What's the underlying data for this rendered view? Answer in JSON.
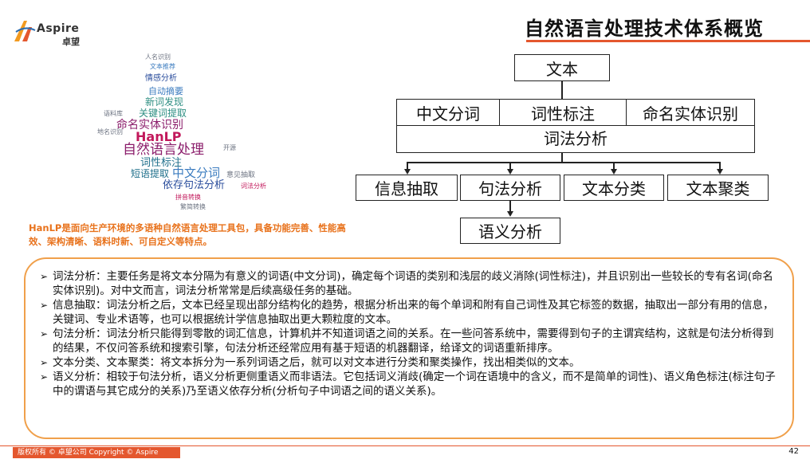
{
  "header": {
    "logo_brand": "Aspire",
    "logo_brand_cn": "卓望",
    "title": "自然语言处理技术体系概览",
    "accent_color": "#e4572e"
  },
  "wordcloud": {
    "words": [
      "自然语言处理",
      "HanLP",
      "命名实体识别",
      "依存句法分析",
      "中文分词",
      "词性标注",
      "关键词提取",
      "新词发现",
      "自动摘要",
      "情感分析",
      "短语提取",
      "人名识别",
      "文本推荐",
      "地名识别",
      "拼音转换",
      "意见抽取",
      "语料库",
      "繁简转换",
      "开源",
      "词法分析"
    ]
  },
  "intro_text": "HanLP是面向生产环境的多语种自然语言处理工具包，具备功能完善、性能高效、架构清晰、语料时新、可自定义等特点。",
  "diagram": {
    "top": "文本",
    "row1": [
      "中文分词",
      "词性标注",
      "命名实体识别"
    ],
    "lexical": "词法分析",
    "row2": [
      "信息抽取",
      "句法分析",
      "文本分类",
      "文本聚类"
    ],
    "semantic": "语义分析"
  },
  "bullets": [
    "词法分析：主要任务是将文本分隔为有意义的词语(中文分词)，确定每个词语的类别和浅层的歧义消除(词性标注)，并且识别出一些较长的专有名词(命名实体识别)。对中文而言，词法分析常常是后续高级任务的基础。",
    "信息抽取：词法分析之后，文本已经呈现出部分结构化的趋势，根据分析出来的每个单词和附有自己词性及其它标签的数据，抽取出一部分有用的信息，关键词、专业术语等，也可以根据统计学信息抽取出更大颗粒度的文本。",
    "句法分析：词法分析只能得到零散的词汇信息，计算机并不知道词语之间的关系。在一些问答系统中，需要得到句子的主谓宾结构，这就是句法分析得到的结果，不仅问答系统和搜索引擎，句法分析还经常应用有基于短语的机器翻译，给译文的词语重新排序。",
    "文本分类、文本聚类：将文本拆分为一系列词语之后，就可以对文本进行分类和聚类操作，找出相类似的文本。",
    "语义分析：相较于句法分析，语义分析更侧重语义而非语法。它包括词义消歧(确定一个词在语境中的含义，而不是简单的词性)、语义角色标注(标注句子中的谓语与其它成分的关系)乃至语义依存分析(分析句子中词语之间的语义关系)。"
  ],
  "footer": {
    "copyright": "版权所有 © 卓望公司 Copyright © Aspire",
    "page_number": "42"
  }
}
